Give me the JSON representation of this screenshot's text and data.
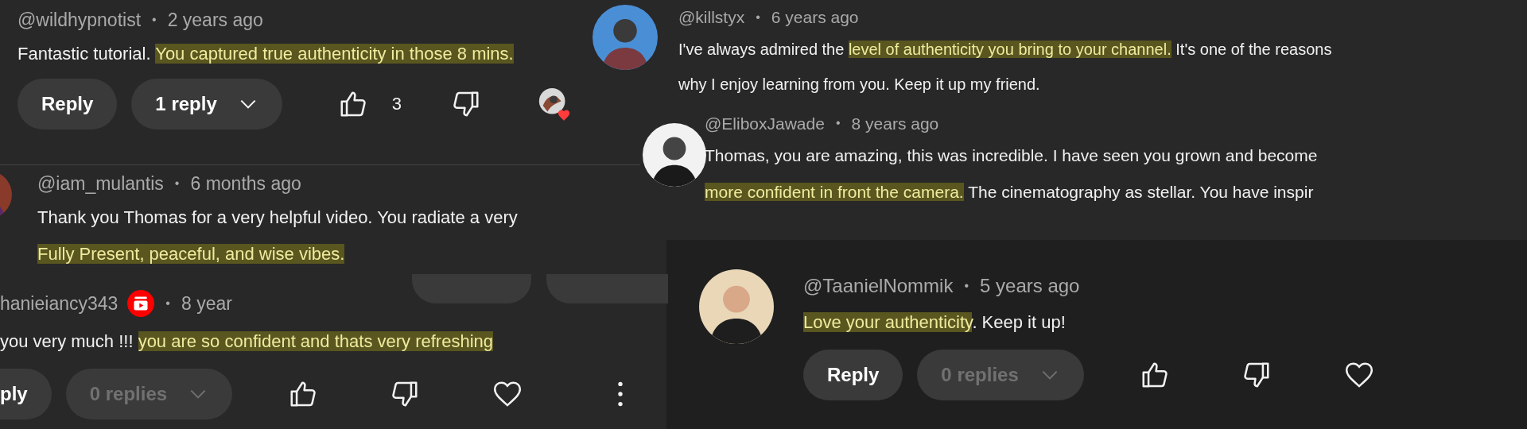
{
  "comments": [
    {
      "author": "@wildhypnotist",
      "separator": "•",
      "time": "2 years ago",
      "member_badge": false,
      "lines": [
        [
          {
            "text": "Fantastic tutorial. ",
            "highlighted": false
          },
          {
            "text": "You captured true authenticity in those 8 mins.",
            "highlighted": true
          }
        ]
      ],
      "actions": {
        "reply": "Reply",
        "replies": "1 reply",
        "replies_disabled": false,
        "likes": "3",
        "hearted": true
      }
    },
    {
      "author": "@iam_mulantis",
      "separator": "•",
      "time": "6 months ago",
      "member_badge": false,
      "lines": [
        [
          {
            "text": "Thank you Thomas for a very helpful video. You radiate a very",
            "highlighted": false
          }
        ],
        [
          {
            "text": "Fully Present, peaceful, and wise vibes.",
            "highlighted": true
          }
        ]
      ]
    },
    {
      "author": "hanieiancy343",
      "separator": "•",
      "time": "8 year",
      "member_badge": true,
      "lines": [
        [
          {
            "text": "you very much !!! ",
            "highlighted": false
          },
          {
            "text": "you are so confident and thats very refreshing",
            "highlighted": true
          }
        ]
      ],
      "actions": {
        "reply": "ply",
        "replies": "0 replies",
        "replies_disabled": true,
        "hearted": false
      }
    },
    {
      "author": "@killstyx",
      "separator": "•",
      "time": "6 years ago",
      "member_badge": false,
      "lines": [
        [
          {
            "text": "I've always admired the ",
            "highlighted": false
          },
          {
            "text": "level of authenticity you bring to your channel.",
            "highlighted": true
          },
          {
            "text": " It's one of the reasons",
            "highlighted": false
          }
        ],
        [
          {
            "text": "why I enjoy learning from you. Keep it up my friend.",
            "highlighted": false
          }
        ]
      ],
      "replies": [
        {
          "author": "@EliboxJawade",
          "separator": "•",
          "time": "8 years ago",
          "lines": [
            [
              {
                "text": "Thomas, you are amazing, this was incredible. I have seen you grown and become",
                "highlighted": false
              }
            ],
            [
              {
                "text": "more confident in front the camera.",
                "highlighted": true
              },
              {
                "text": " The cinematography as stellar. You have inspir",
                "highlighted": false
              }
            ]
          ]
        }
      ]
    },
    {
      "author": "@TaanielNommik",
      "separator": "•",
      "time": "5 years ago",
      "member_badge": false,
      "lines": [
        [
          {
            "text": "Love your authenticity",
            "highlighted": true
          },
          {
            "text": ". Keep it up!",
            "highlighted": false
          }
        ]
      ],
      "actions": {
        "reply": "Reply",
        "replies": "0 replies",
        "replies_disabled": true,
        "hearted": false
      }
    }
  ]
}
